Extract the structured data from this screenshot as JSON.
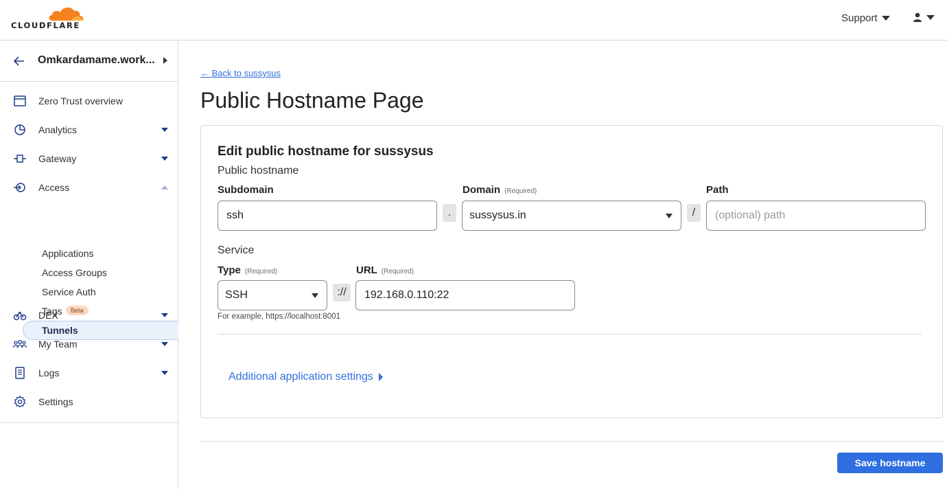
{
  "colors": {
    "accent": "#2f6fe0",
    "brand_orange": "#f6821f",
    "nav_icon": "#1e3a8a"
  },
  "topbar": {
    "logo_text": "CLOUDFLARE",
    "support_label": "Support",
    "user_icon": "user-icon"
  },
  "sidebar": {
    "account_name": "Omkardamame.work...",
    "items": [
      {
        "label": "Zero Trust overview",
        "icon": "browser-window-icon"
      },
      {
        "label": "Analytics",
        "icon": "pie-chart-icon"
      },
      {
        "label": "Gateway",
        "icon": "gateway-icon"
      },
      {
        "label": "Access",
        "icon": "access-icon"
      },
      {
        "label": "DEX",
        "icon": "bicycle-icon"
      },
      {
        "label": "My Team",
        "icon": "team-icon"
      },
      {
        "label": "Logs",
        "icon": "document-icon"
      },
      {
        "label": "Settings",
        "icon": "gear-icon"
      }
    ],
    "access_sub": [
      {
        "label": "Applications"
      },
      {
        "label": "Access Groups"
      },
      {
        "label": "Service Auth"
      },
      {
        "label": "Tags",
        "badge": "Beta"
      },
      {
        "label": "Tunnels",
        "active": true
      }
    ]
  },
  "main": {
    "back_link": "← Back to sussysus",
    "page_title": "Public Hostname Page",
    "card": {
      "title": "Edit public hostname for sussysus",
      "hostname_section": "Public hostname",
      "subdomain_label": "Subdomain",
      "subdomain_value": "ssh",
      "dot_sep": ".",
      "domain_label": "Domain",
      "domain_required": "(Required)",
      "domain_value": "sussysus.in",
      "slash_sep": "/",
      "path_label": "Path",
      "path_placeholder": "(optional) path",
      "service_section": "Service",
      "type_label": "Type",
      "type_required": "(Required)",
      "type_value": "SSH",
      "scheme_sep": "://",
      "url_label": "URL",
      "url_required": "(Required)",
      "url_value": "192.168.0.110:22",
      "type_hint": "For example, https://localhost:8001",
      "additional_settings": "Additional application settings"
    },
    "save_button": "Save hostname"
  }
}
